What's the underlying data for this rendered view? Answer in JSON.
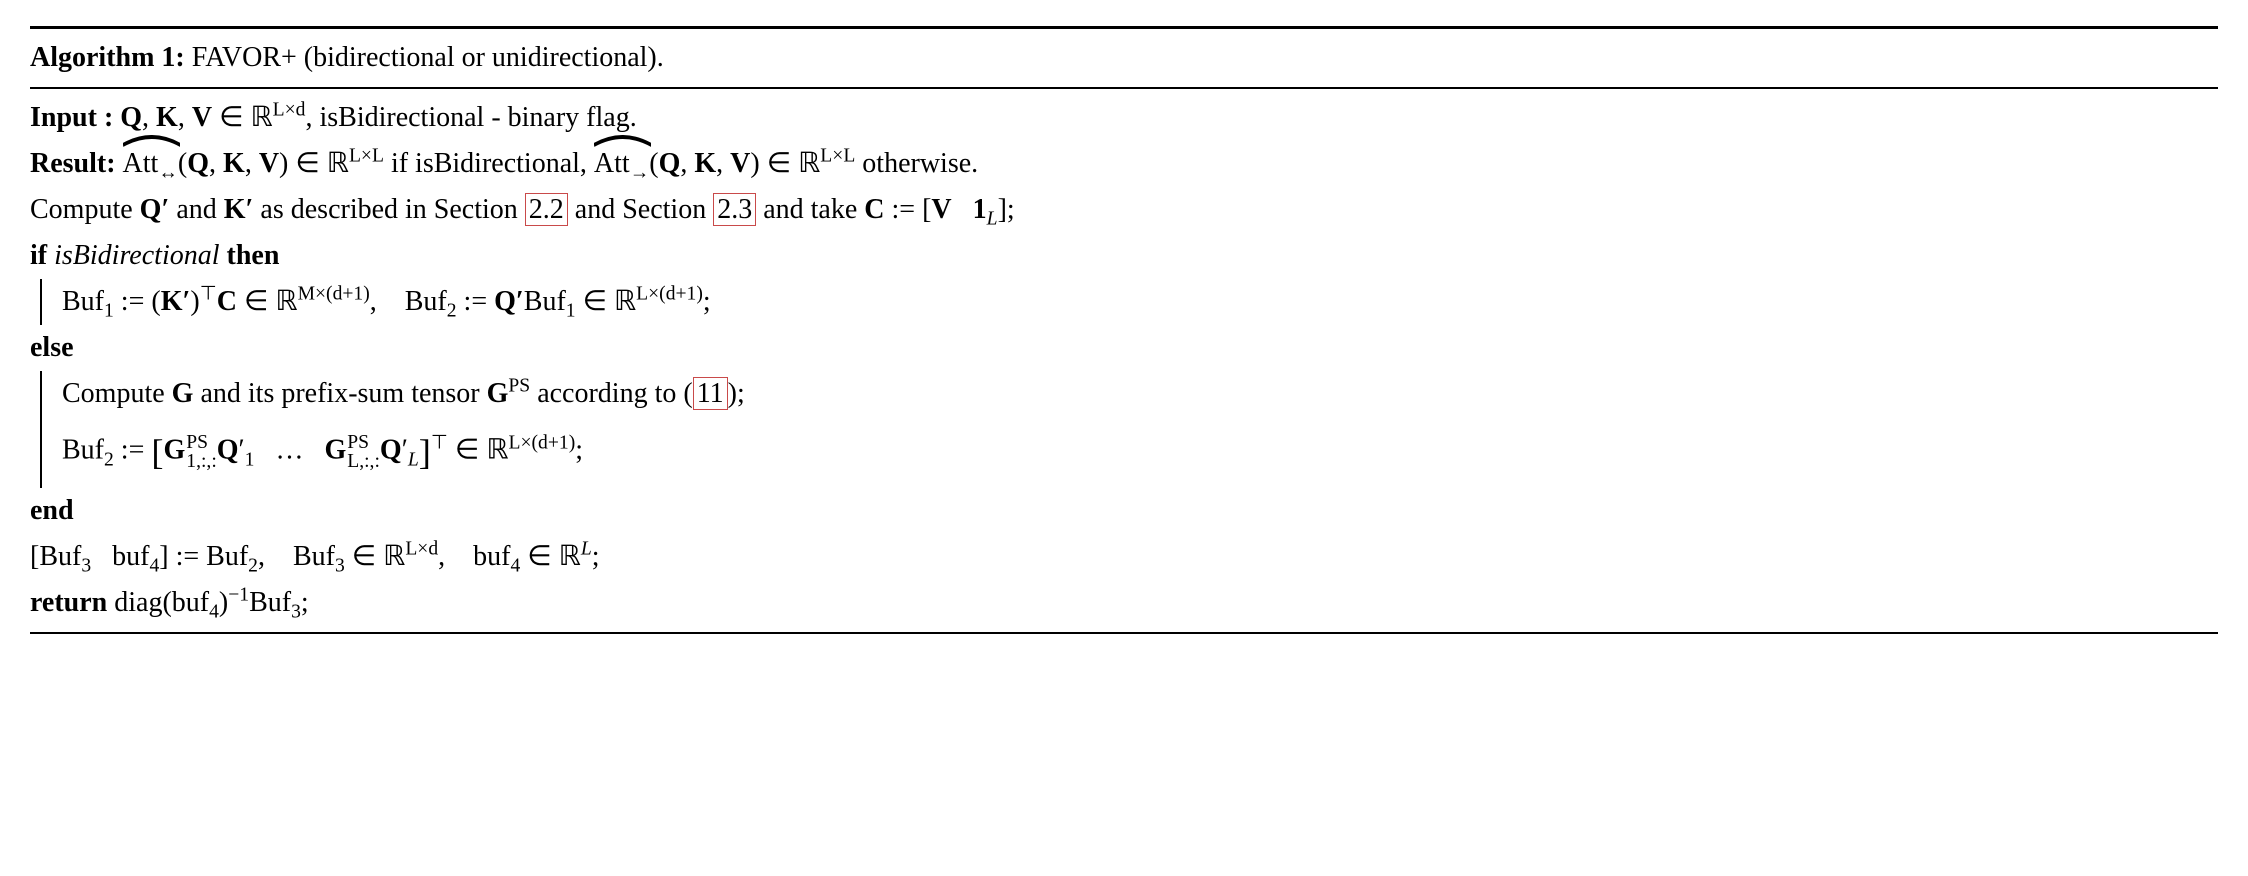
{
  "algo": {
    "label": "Algorithm 1:",
    "title": "FAVOR+ (bidirectional or unidirectional).",
    "input_label": "Input :",
    "input_body_a": "Q, K, V ∈ ℝ",
    "input_exp1": "L×d",
    "input_body_b": ", isBidirectional - binary flag.",
    "result_label": "Result:",
    "result_hat1": "Att",
    "result_sub1": "↔",
    "result_args": "(Q, K, V) ∈ ℝ",
    "result_exp_LL": "L×L",
    "result_mid": " if isBidirectional, ",
    "result_hat2": "Att",
    "result_sub2": "→",
    "result_tail": " otherwise.",
    "compute_a": "Compute ",
    "compute_b": "Q′",
    "compute_c": " and ",
    "compute_d": "K′",
    "compute_e": " as described in Section ",
    "ref1": "2.2",
    "compute_f": " and Section ",
    "ref2": "2.3",
    "compute_g": " and take ",
    "compute_h": "C := [V   1",
    "compute_h_sub": "L",
    "compute_i": "];",
    "if_label": "if",
    "if_cond": " isBidirectional ",
    "then_label": "then",
    "buf1_a": "Buf",
    "buf1_sub": "1",
    "buf1_b": " := (K′)",
    "buf1_sup": "⊤",
    "buf1_c": "C ∈ ℝ",
    "buf1_exp": "M×(d+1)",
    "buf1_comma": ",    Buf",
    "buf1_sub2": "2",
    "buf1_d": " := Q′Buf",
    "buf1_sub3": "1",
    "buf1_e": " ∈ ℝ",
    "buf1_exp2": "L×(d+1)",
    "buf1_semi": ";",
    "else_label": "else",
    "else_compute_a": "Compute ",
    "else_compute_b": "G",
    "else_compute_c": " and its prefix-sum tensor ",
    "else_compute_d": "G",
    "else_compute_sup": "PS",
    "else_compute_e": " according to (",
    "ref3": "11",
    "else_compute_f": ");",
    "else_buf_a": "Buf",
    "else_buf_sub": "2",
    "else_buf_b": " := ",
    "else_buf_open": "[",
    "else_buf_g1": "G",
    "else_buf_g1_top": "PS",
    "else_buf_g1_bot": "1,:,:",
    "else_buf_q1": "Q′",
    "else_buf_q1_sub": "1",
    "else_buf_dots": "   …   ",
    "else_buf_gL": "G",
    "else_buf_gL_top": "PS",
    "else_buf_gL_bot": "L,:,:",
    "else_buf_qL": "Q′",
    "else_buf_qL_sub": "L",
    "else_buf_close": "]",
    "else_buf_trans": "⊤",
    "else_buf_in": " ∈ ℝ",
    "else_buf_exp": "L×(d+1)",
    "else_buf_semi": ";",
    "end_label": "end",
    "split_a": "[Buf",
    "split_sub3": "3",
    "split_b": "   buf",
    "split_sub4": "4",
    "split_c": "] := Buf",
    "split_sub2": "2",
    "split_d": ",    Buf",
    "split_sub3b": "3",
    "split_e": " ∈ ℝ",
    "split_exp1": "L×d",
    "split_f": ",    buf",
    "split_sub4b": "4",
    "split_g": " ∈ ℝ",
    "split_exp2": "L",
    "split_semi": ";",
    "return_label": "return",
    "return_a": " diag(buf",
    "return_sub": "4",
    "return_b": ")",
    "return_sup": "−1",
    "return_c": "Buf",
    "return_sub3": "3",
    "return_semi": ";"
  }
}
